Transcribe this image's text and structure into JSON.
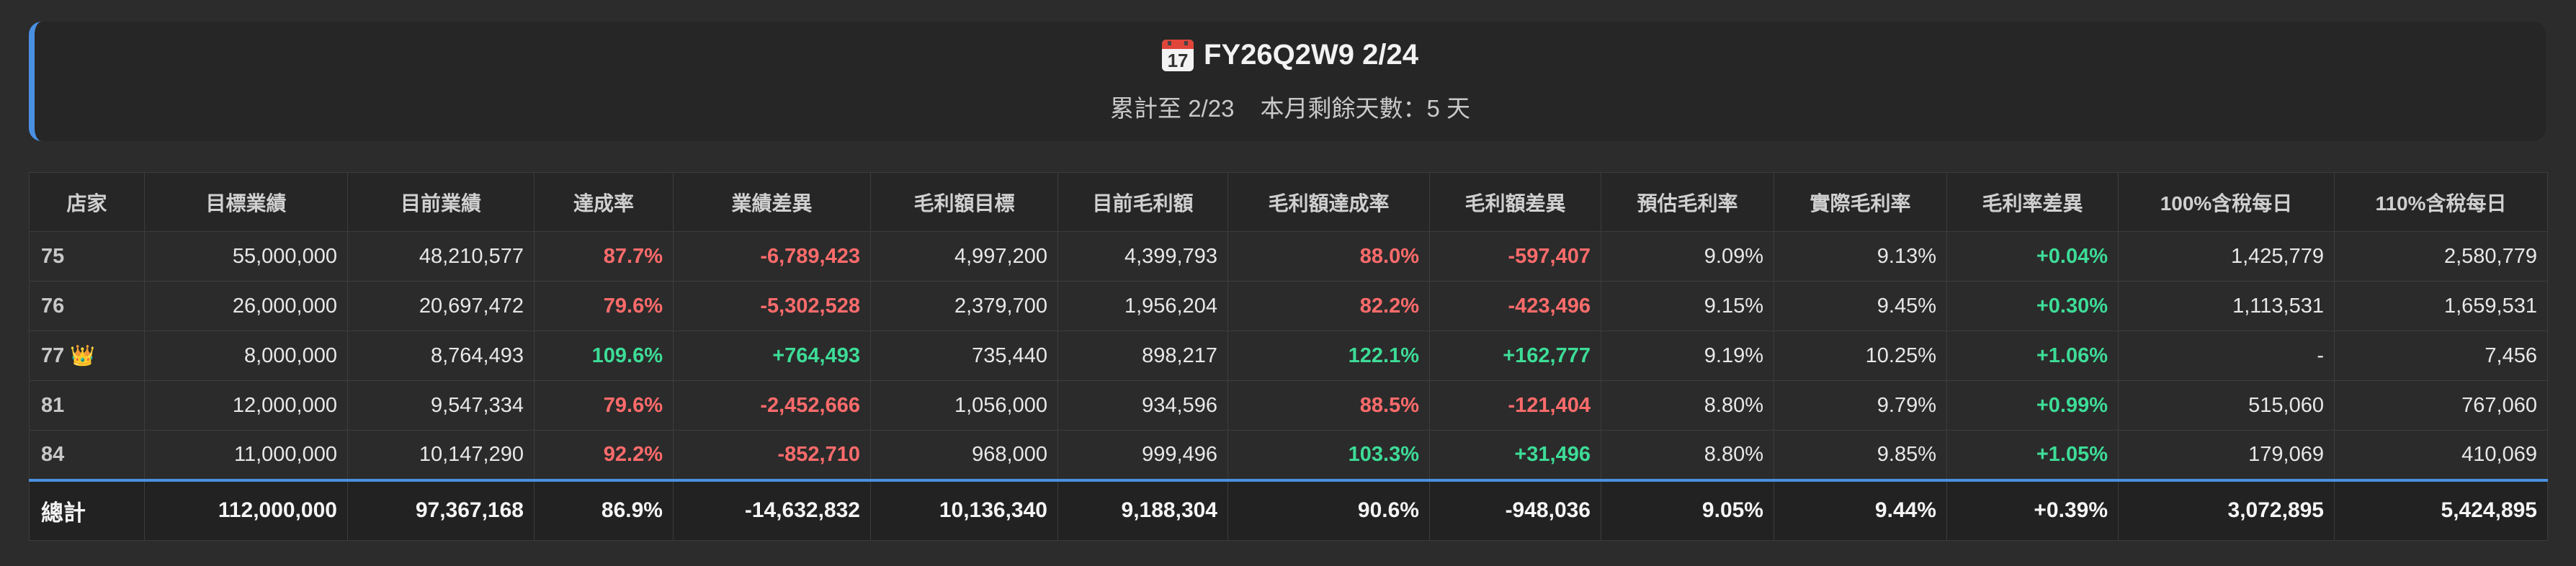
{
  "header": {
    "calendar_icon_text": "17",
    "title": "FY26Q2W9 2/24",
    "cumulative": "累計至 2/23",
    "days_left": "本月剩餘天數：5 天"
  },
  "colors": {
    "accent": "#4a90e2",
    "negative": "#ff6b6b",
    "positive": "#3ddc97"
  },
  "table": {
    "columns": [
      "店家",
      "目標業績",
      "目前業績",
      "達成率",
      "業績差異",
      "毛利額目標",
      "目前毛利額",
      "毛利額達成率",
      "毛利額差異",
      "預估毛利率",
      "實際毛利率",
      "毛利率差異",
      "100%含稅每日",
      "110%含稅每日"
    ],
    "rows": [
      {
        "store": "75",
        "target": "55,000,000",
        "current": "48,210,577",
        "rate": "87.7%",
        "diff": "-6,789,423",
        "gp_target": "4,997,200",
        "gp_current": "4,399,793",
        "gp_rate": "88.0%",
        "gp_diff": "-597,407",
        "est_margin": "9.09%",
        "act_margin": "9.13%",
        "margin_diff": "+0.04%",
        "daily100": "1,425,779",
        "daily110": "2,580,779"
      },
      {
        "store": "76",
        "target": "26,000,000",
        "current": "20,697,472",
        "rate": "79.6%",
        "diff": "-5,302,528",
        "gp_target": "2,379,700",
        "gp_current": "1,956,204",
        "gp_rate": "82.2%",
        "gp_diff": "-423,496",
        "est_margin": "9.15%",
        "act_margin": "9.45%",
        "margin_diff": "+0.30%",
        "daily100": "1,113,531",
        "daily110": "1,659,531"
      },
      {
        "store": "77",
        "crown": "👑",
        "target": "8,000,000",
        "current": "8,764,493",
        "rate": "109.6%",
        "diff": "+764,493",
        "gp_target": "735,440",
        "gp_current": "898,217",
        "gp_rate": "122.1%",
        "gp_diff": "+162,777",
        "est_margin": "9.19%",
        "act_margin": "10.25%",
        "margin_diff": "+1.06%",
        "daily100": "-",
        "daily110": "7,456"
      },
      {
        "store": "81",
        "target": "12,000,000",
        "current": "9,547,334",
        "rate": "79.6%",
        "diff": "-2,452,666",
        "gp_target": "1,056,000",
        "gp_current": "934,596",
        "gp_rate": "88.5%",
        "gp_diff": "-121,404",
        "est_margin": "8.80%",
        "act_margin": "9.79%",
        "margin_diff": "+0.99%",
        "daily100": "515,060",
        "daily110": "767,060"
      },
      {
        "store": "84",
        "target": "11,000,000",
        "current": "10,147,290",
        "rate": "92.2%",
        "diff": "-852,710",
        "gp_target": "968,000",
        "gp_current": "999,496",
        "gp_rate": "103.3%",
        "gp_diff": "+31,496",
        "est_margin": "8.80%",
        "act_margin": "9.85%",
        "margin_diff": "+1.05%",
        "daily100": "179,069",
        "daily110": "410,069"
      }
    ],
    "total": {
      "store": "總計",
      "target": "112,000,000",
      "current": "97,367,168",
      "rate": "86.9%",
      "diff": "-14,632,832",
      "gp_target": "10,136,340",
      "gp_current": "9,188,304",
      "gp_rate": "90.6%",
      "gp_diff": "-948,036",
      "est_margin": "9.05%",
      "act_margin": "9.44%",
      "margin_diff": "+0.39%",
      "daily100": "3,072,895",
      "daily110": "5,424,895"
    }
  }
}
